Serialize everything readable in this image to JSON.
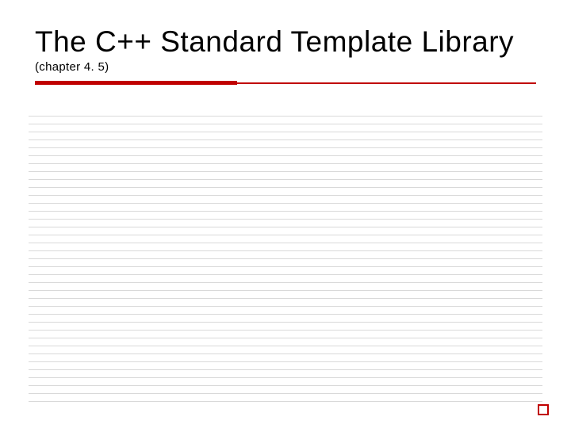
{
  "slide": {
    "title_main": "The C++ Standard Template Library",
    "title_sub": "(chapter 4. 5)"
  },
  "colors": {
    "accent": "#c00000",
    "line": "#d9d9d9"
  }
}
